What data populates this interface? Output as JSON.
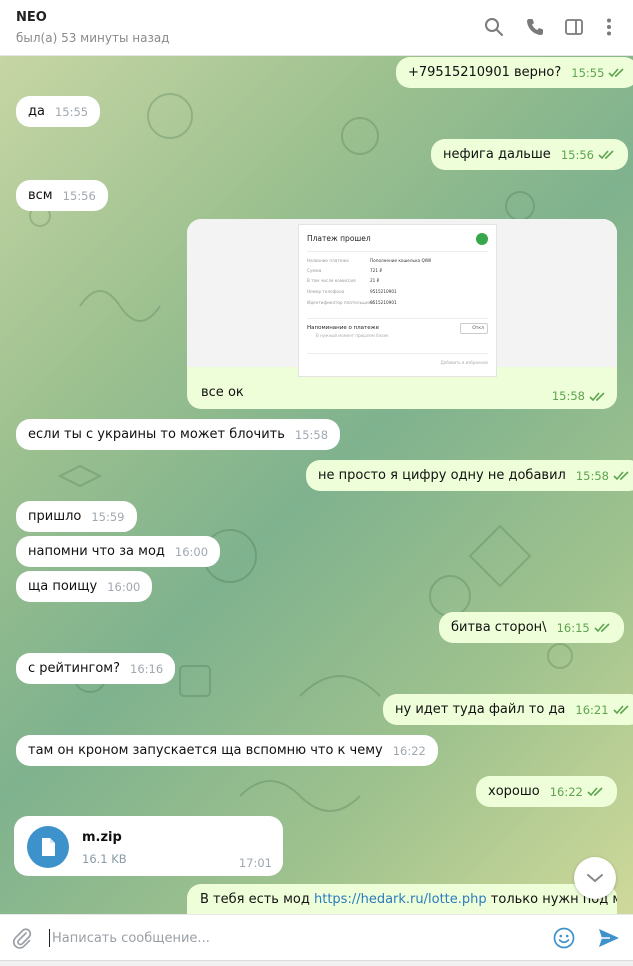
{
  "header": {
    "title": "NEO",
    "status": "был(а) 53 минуты назад",
    "icons": [
      "search-icon",
      "phone-icon",
      "sidebar-toggle-icon",
      "more-vertical-icon"
    ]
  },
  "colors": {
    "outgoing_bubble": "#eefed8",
    "incoming_bubble": "#ffffff",
    "outgoing_time": "#5ea450",
    "incoming_time": "#a0a8b0",
    "accent": "#3e92cc",
    "link": "#2b7bbf"
  },
  "messages": [
    {
      "dir": "out",
      "text": "+79515210901 верно?",
      "time": "15:55"
    },
    {
      "dir": "in",
      "text": "да",
      "time": "15:55"
    },
    {
      "dir": "out",
      "text": "нефига дальше",
      "time": "15:56"
    },
    {
      "dir": "in",
      "text": "всм",
      "time": "15:56"
    },
    {
      "dir": "in",
      "text": "если ты с украины то может блочить",
      "time": "15:58"
    },
    {
      "dir": "out",
      "text": "не просто я цифру одну не добавил",
      "time": "15:58"
    },
    {
      "dir": "in",
      "text": "пришло",
      "time": "15:59"
    },
    {
      "dir": "in",
      "text": "напомни что за мод",
      "time": "16:00"
    },
    {
      "dir": "in",
      "text": "ща поищу",
      "time": "16:00"
    },
    {
      "dir": "out",
      "text": "битва сторон\\",
      "time": "16:15"
    },
    {
      "dir": "in",
      "text": "с рейтингом?",
      "time": "16:16"
    },
    {
      "dir": "out",
      "text": "ну идет туда файл то да",
      "time": "16:21"
    },
    {
      "dir": "in",
      "text": "там он кроном запускается ща вспомню что к чему",
      "time": "16:22"
    },
    {
      "dir": "out",
      "text": "хорошо",
      "time": "16:22"
    }
  ],
  "photo_message": {
    "caption": "все ок",
    "time": "15:58",
    "receipt": {
      "title": "Платеж прошел",
      "rows": [
        {
          "label": "Название платежа",
          "value": "Пополнение кошелька QIWI"
        },
        {
          "label": "Сумма",
          "value": "721 ₽"
        },
        {
          "label": "В том числе комиссия",
          "value": "21 ₽"
        },
        {
          "label": "Номер телефона",
          "value": "9515210901"
        },
        {
          "label": "Идентификатор плательщика",
          "value": "9515210901"
        }
      ],
      "reminder": "Напоминание о платеже",
      "reminder_sub": "В нужный момент пришлем бланк",
      "toggle": "Откл",
      "footer": "Добавить в избранное"
    }
  },
  "file_message": {
    "name": "m.zip",
    "size": "16.1 KB",
    "time": "17:01"
  },
  "last_message": {
    "prefix": "В тебя есть мод ",
    "link": "https://hedark.ru/lotte.php",
    "suffix": " только нужн под мой"
  },
  "composer": {
    "placeholder": "Написать сообщение..."
  }
}
